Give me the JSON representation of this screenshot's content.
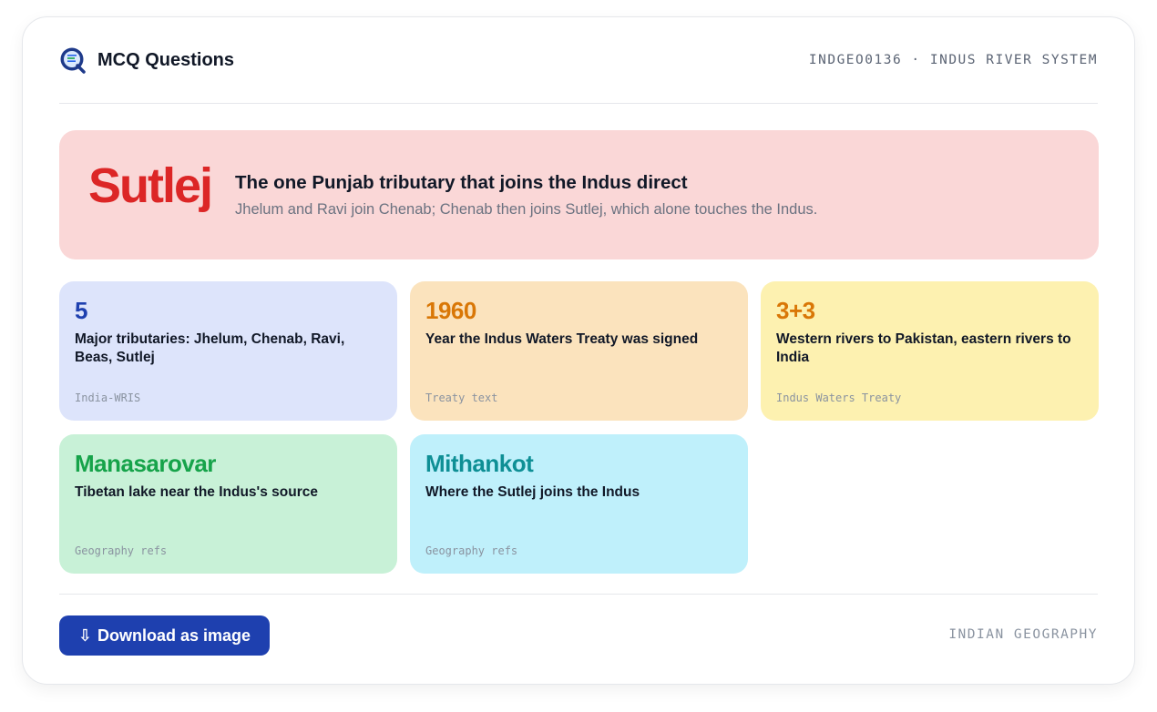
{
  "header": {
    "brand_title": "MCQ Questions",
    "meta": "INDGEO0136 · INDUS RIVER SYSTEM"
  },
  "hero": {
    "word": "Sutlej",
    "title": "The one Punjab tributary that joins the Indus direct",
    "subtitle": "Jhelum and Ravi join Chenab; Chenab then joins Sutlej, which alone touches the Indus."
  },
  "tiles": [
    {
      "value": "5",
      "desc": "Major tributaries: Jhelum, Chenab, Ravi, Beas, Sutlej",
      "source": "India-WRIS",
      "bg": "#dde4fb",
      "color": "#1e40af"
    },
    {
      "value": "1960",
      "desc": "Year the Indus Waters Treaty was signed",
      "source": "Treaty text",
      "bg": "#fbe3bd",
      "color": "#d97706"
    },
    {
      "value": "3+3",
      "desc": "Western rivers to Pakistan, eastern rivers to India",
      "source": "Indus Waters Treaty",
      "bg": "#fdf1b0",
      "color": "#d97706"
    },
    {
      "value": "Manasarovar",
      "desc": "Tibetan lake near the Indus's source",
      "source": "Geography refs",
      "bg": "#c8f1d7",
      "color": "#16a34a"
    },
    {
      "value": "Mithankot",
      "desc": "Where the Sutlej joins the Indus",
      "source": "Geography refs",
      "bg": "#bff0fb",
      "color": "#0e8f95"
    }
  ],
  "footer": {
    "download_label": "Download as image",
    "download_icon": "⇩",
    "tag": "INDIAN GEOGRAPHY"
  },
  "colors": {
    "accent": "#1e40af",
    "hero_bg": "#fad7d7",
    "hero_word": "#dc2626"
  },
  "icons": {
    "brand": "quiz-logo-icon",
    "download": "download-arrow-icon"
  }
}
